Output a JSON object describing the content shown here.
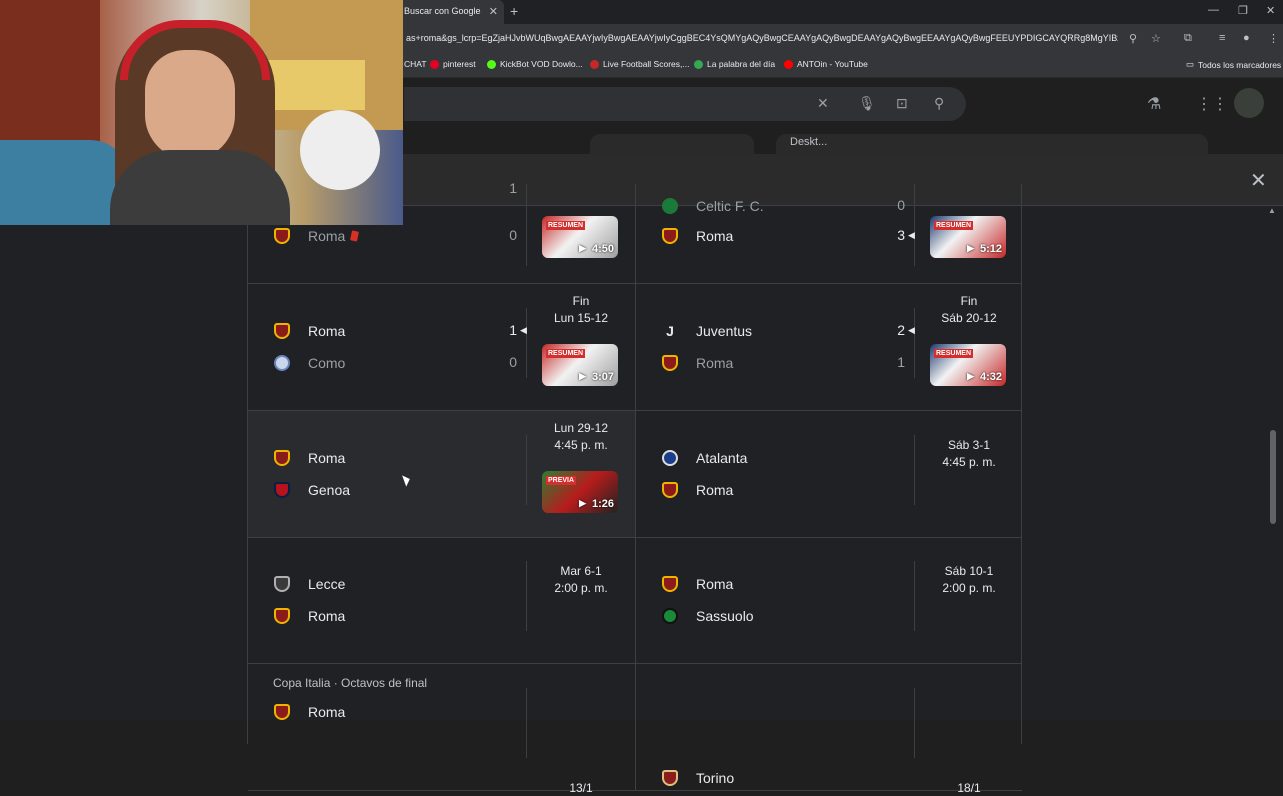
{
  "browser": {
    "tab_title": "Buscar con Google",
    "url": "as+roma&gs_lcrp=EgZjaHJvbWUqBwgAEAAYjwIyBwgAEAAYjwIyCggBEC4YsQMYgAQyBwgCEAAYgAQyBwgDEAAYgAQyBwgEEAAYgAQyBwgFEEUYPDIGCAYQRRg8MgYIBxBF...",
    "bookmarks": [
      "CHAT",
      "pinterest",
      "KickBot VOD Dowlo...",
      "Live Football Scores,...",
      "La palabra del día",
      "ANTOin - YouTube"
    ],
    "all_bookmarks": "Todos los marcadores"
  },
  "search": {
    "partial_pill": "Deskt..."
  },
  "matches": [
    {
      "row": 0,
      "col": 0,
      "home": {
        "name": "",
        "score": ""
      },
      "away": {
        "name": "Roma",
        "score": "0",
        "crest": "roma",
        "lose": true,
        "red_card": true
      },
      "top_partial": "1",
      "video": {
        "duration": "4:50",
        "badge": "RESUMEN"
      }
    },
    {
      "row": 0,
      "col": 1,
      "home": {
        "name": "Celtic F. C.",
        "score": "0",
        "crest": "celtic",
        "lose": true
      },
      "away": {
        "name": "Roma",
        "score": "3",
        "crest": "roma",
        "winner": true
      },
      "video": {
        "duration": "5:12",
        "badge": "RESUMEN"
      }
    },
    {
      "row": 1,
      "col": 0,
      "status": "Fin",
      "date": "Lun 15-12",
      "home": {
        "name": "Roma",
        "score": "1",
        "crest": "roma",
        "winner": true
      },
      "away": {
        "name": "Como",
        "score": "0",
        "crest": "como",
        "lose": true
      },
      "video": {
        "duration": "3:07",
        "badge": "RESUMEN"
      }
    },
    {
      "row": 1,
      "col": 1,
      "status": "Fin",
      "date": "Sáb 20-12",
      "home": {
        "name": "Juventus",
        "score": "2",
        "crest": "juve",
        "winner": true
      },
      "away": {
        "name": "Roma",
        "score": "1",
        "crest": "roma",
        "lose": true
      },
      "video": {
        "duration": "4:32",
        "badge": "RESUMEN"
      }
    },
    {
      "row": 2,
      "col": 0,
      "date": "Lun 29-12",
      "time": "4:45 p. m.",
      "home": {
        "name": "Roma",
        "crest": "roma"
      },
      "away": {
        "name": "Genoa",
        "crest": "genoa"
      },
      "video": {
        "duration": "1:26",
        "badge": "PREVIA"
      }
    },
    {
      "row": 2,
      "col": 1,
      "date": "Sáb 3-1",
      "time": "4:45 p. m.",
      "home": {
        "name": "Atalanta",
        "crest": "atalanta"
      },
      "away": {
        "name": "Roma",
        "crest": "roma"
      }
    },
    {
      "row": 3,
      "col": 0,
      "date": "Mar 6-1",
      "time": "2:00 p. m.",
      "home": {
        "name": "Lecce",
        "crest": "lecce"
      },
      "away": {
        "name": "Roma",
        "crest": "roma"
      }
    },
    {
      "row": 3,
      "col": 1,
      "date": "Sáb 10-1",
      "time": "2:00 p. m.",
      "home": {
        "name": "Roma",
        "crest": "roma"
      },
      "away": {
        "name": "Sassuolo",
        "crest": "sassuolo"
      }
    },
    {
      "row": 4,
      "col": 0,
      "competition": "Copa Italia · Octavos de final",
      "date": "13/1",
      "home": {
        "name": "Roma",
        "crest": "roma"
      }
    },
    {
      "row": 4,
      "col": 1,
      "date": "18/1",
      "home": {
        "name": "Torino",
        "crest": "torino"
      }
    }
  ],
  "colors": {
    "background": "#202124",
    "panel_bar": "#2b2b2b",
    "text": "#e8eaed",
    "muted": "#9aa0a6",
    "border": "#3c4043",
    "hover_cell": "#2a2b2e"
  },
  "icons": {
    "panel_close": "close-icon",
    "search_clear": "close-icon",
    "voice": "mic-icon",
    "lens": "camera-icon",
    "search": "search-icon",
    "labs": "flask-icon",
    "apps": "apps-grid-icon"
  }
}
